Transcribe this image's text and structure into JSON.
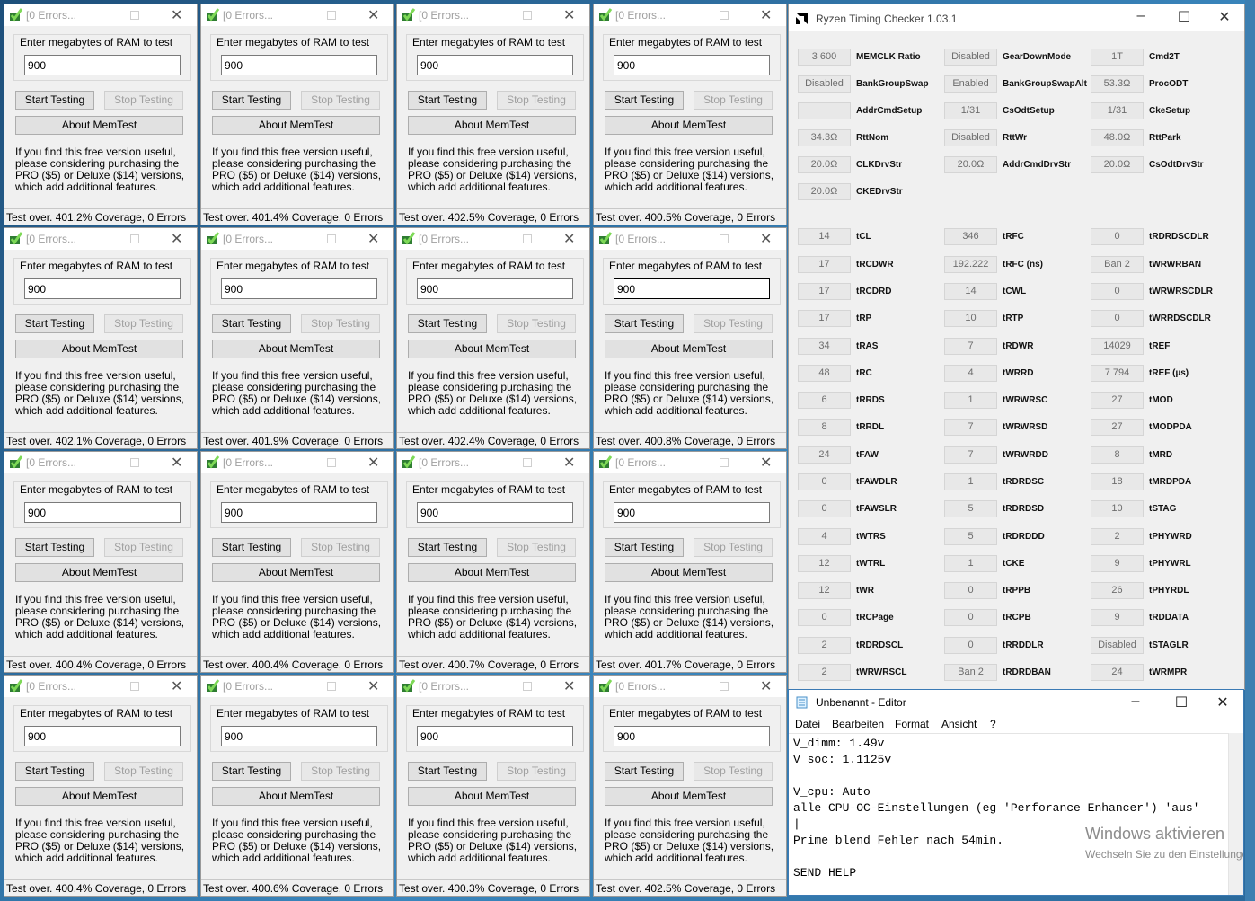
{
  "memtest": {
    "title": "[0 Errors...",
    "prompt": "Enter megabytes of RAM to test",
    "value": "900",
    "start_label": "Start Testing",
    "stop_label": "Stop Testing",
    "about_label": "About MemTest",
    "note": "If you find this free version useful, please considering purchasing the PRO ($5) or Deluxe ($14) versions, which add additional features.",
    "statuses": [
      "Test over. 401.2% Coverage, 0 Errors",
      "Test over. 401.4% Coverage, 0 Errors",
      "Test over. 402.5% Coverage, 0 Errors",
      "Test over. 400.5% Coverage, 0 Errors",
      "Test over. 402.1% Coverage, 0 Errors",
      "Test over. 401.9% Coverage, 0 Errors",
      "Test over. 402.4% Coverage, 0 Errors",
      "Test over. 400.8% Coverage, 0 Errors",
      "Test over. 400.4% Coverage, 0 Errors",
      "Test over. 400.4% Coverage, 0 Errors",
      "Test over. 400.7% Coverage, 0 Errors",
      "Test over. 401.7% Coverage, 0 Errors",
      "Test over. 400.4% Coverage, 0 Errors",
      "Test over. 400.6% Coverage, 0 Errors",
      "Test over. 400.3% Coverage, 0 Errors",
      "Test over. 402.5% Coverage, 0 Errors"
    ]
  },
  "rtc": {
    "title": "Ryzen Timing Checker 1.03.1",
    "rows": [
      [
        [
          "3 600",
          "MEMCLK Ratio"
        ],
        [
          "Disabled",
          "GearDownMode"
        ],
        [
          "1T",
          "Cmd2T"
        ]
      ],
      [
        [
          "Disabled",
          "BankGroupSwap"
        ],
        [
          "Enabled",
          "BankGroupSwapAlt"
        ],
        [
          "53.3Ω",
          "ProcODT"
        ]
      ],
      [
        [
          "",
          "AddrCmdSetup"
        ],
        [
          "1/31",
          "CsOdtSetup"
        ],
        [
          "1/31",
          "CkeSetup"
        ]
      ],
      [
        [
          "34.3Ω",
          "RttNom"
        ],
        [
          "Disabled",
          "RttWr"
        ],
        [
          "48.0Ω",
          "RttPark"
        ]
      ],
      [
        [
          "20.0Ω",
          "CLKDrvStr"
        ],
        [
          "20.0Ω",
          "AddrCmdDrvStr"
        ],
        [
          "20.0Ω",
          "CsOdtDrvStr"
        ]
      ],
      [
        [
          "20.0Ω",
          "CKEDrvStr"
        ]
      ],
      [
        [
          "14",
          "tCL"
        ],
        [
          "346",
          "tRFC"
        ],
        [
          "0",
          "tRDRDSCDLR"
        ]
      ],
      [
        [
          "17",
          "tRCDWR"
        ],
        [
          "192.222",
          "tRFC (ns)"
        ],
        [
          "Ban 2",
          "tWRWRBAN"
        ]
      ],
      [
        [
          "17",
          "tRCDRD"
        ],
        [
          "14",
          "tCWL"
        ],
        [
          "0",
          "tWRWRSCDLR"
        ]
      ],
      [
        [
          "17",
          "tRP"
        ],
        [
          "10",
          "tRTP"
        ],
        [
          "0",
          "tWRRDSCDLR"
        ]
      ],
      [
        [
          "34",
          "tRAS"
        ],
        [
          "7",
          "tRDWR"
        ],
        [
          "14029",
          "tREF"
        ]
      ],
      [
        [
          "48",
          "tRC"
        ],
        [
          "4",
          "tWRRD"
        ],
        [
          "7 794",
          "tREF (µs)"
        ]
      ],
      [
        [
          "6",
          "tRRDS"
        ],
        [
          "1",
          "tWRWRSC"
        ],
        [
          "27",
          "tMOD"
        ]
      ],
      [
        [
          "8",
          "tRRDL"
        ],
        [
          "7",
          "tWRWRSD"
        ],
        [
          "27",
          "tMODPDA"
        ]
      ],
      [
        [
          "24",
          "tFAW"
        ],
        [
          "7",
          "tWRWRDD"
        ],
        [
          "8",
          "tMRD"
        ]
      ],
      [
        [
          "0",
          "tFAWDLR"
        ],
        [
          "1",
          "tRDRDSC"
        ],
        [
          "18",
          "tMRDPDA"
        ]
      ],
      [
        [
          "0",
          "tFAWSLR"
        ],
        [
          "5",
          "tRDRDSD"
        ],
        [
          "10",
          "tSTAG"
        ]
      ],
      [
        [
          "4",
          "tWTRS"
        ],
        [
          "5",
          "tRDRDDD"
        ],
        [
          "2",
          "tPHYWRD"
        ]
      ],
      [
        [
          "12",
          "tWTRL"
        ],
        [
          "1",
          "tCKE"
        ],
        [
          "9",
          "tPHYWRL"
        ]
      ],
      [
        [
          "12",
          "tWR"
        ],
        [
          "0",
          "tRPPB"
        ],
        [
          "26",
          "tPHYRDL"
        ]
      ],
      [
        [
          "0",
          "tRCPage"
        ],
        [
          "0",
          "tRCPB"
        ],
        [
          "9",
          "tRDDATA"
        ]
      ],
      [
        [
          "2",
          "tRDRDSCL"
        ],
        [
          "0",
          "tRRDDLR"
        ],
        [
          "Disabled",
          "tSTAGLR"
        ]
      ],
      [
        [
          "2",
          "tWRWRSCL"
        ],
        [
          "Ban 2",
          "tRDRDBAN"
        ],
        [
          "24",
          "tWRMPR"
        ]
      ]
    ]
  },
  "editor": {
    "title": "Unbenannt - Editor",
    "menu": [
      "Datei",
      "Bearbeiten",
      "Format",
      "Ansicht",
      "?"
    ],
    "content": "V_dimm: 1.49v\nV_soc: 1.1125v\n\nV_cpu: Auto\nalle CPU-OC-Einstellungen (eg 'Perforance Enhancer') 'aus'\n|\nPrime blend Fehler nach 54min.\n\nSEND HELP",
    "watermark_title": "Windows aktivieren",
    "watermark_sub": "Wechseln Sie zu den Einstellungen"
  }
}
